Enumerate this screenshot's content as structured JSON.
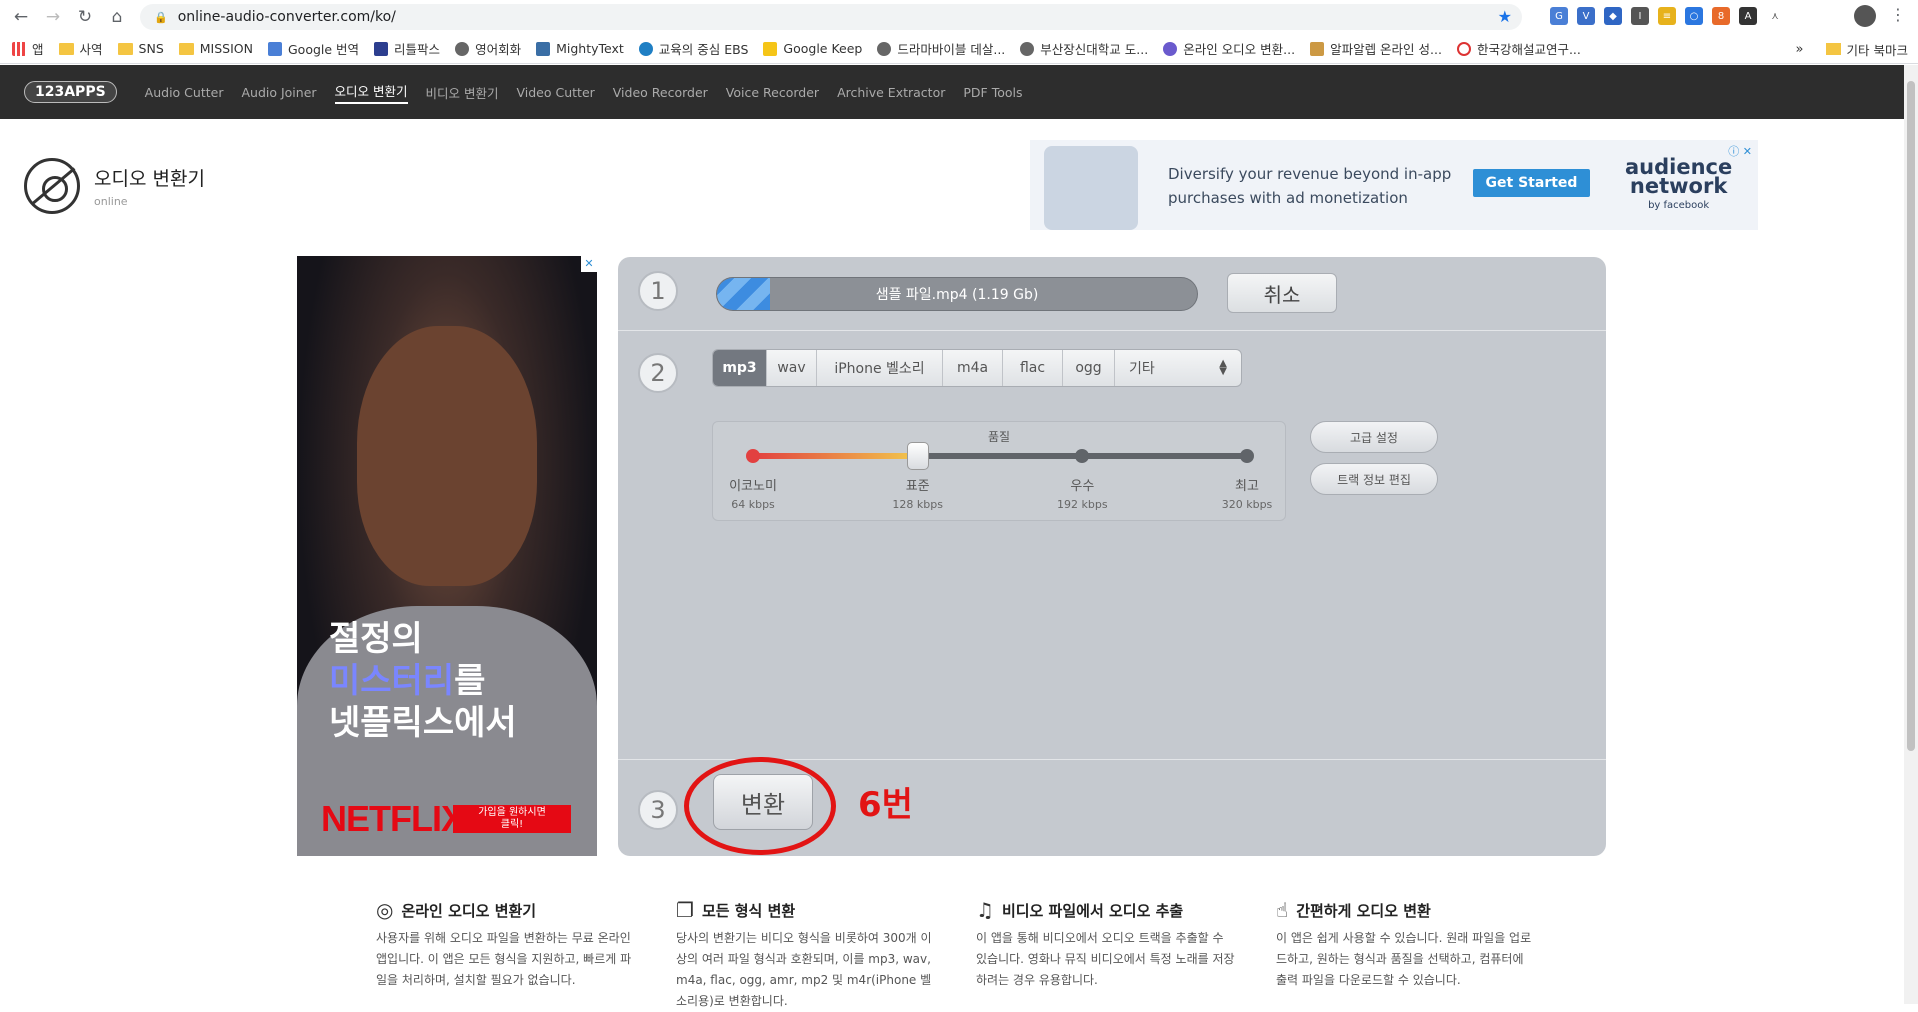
{
  "browser": {
    "url": "online-audio-converter.com/ko/",
    "bookmarks": [
      "앱",
      "사역",
      "SNS",
      "MISSION",
      "Google 번역",
      "리틀팍스",
      "영어회화",
      "MightyText",
      "교육의 중심 EBS",
      "Google Keep",
      "드라마바이블 데살...",
      "부산장신대학교 도...",
      "온라인 오디오 변환...",
      "알파알렙 온라인 성...",
      "한국강해설교연구..."
    ],
    "bookmarks_overflow": "»",
    "other_bookmarks": "기타 북마크"
  },
  "site_nav": {
    "logo": "123APPS",
    "links": [
      "Audio Cutter",
      "Audio Joiner",
      "오디오 변환기",
      "비디오 변환기",
      "Video Cutter",
      "Video Recorder",
      "Voice Recorder",
      "Archive Extractor",
      "PDF Tools"
    ],
    "active_index": 2
  },
  "app": {
    "name": "오디오 변환기",
    "sub": "online"
  },
  "top_ad": {
    "copy_line1": "Diversify your revenue beyond in-app",
    "copy_line2": "purchases with ad monetization",
    "cta": "Get Started",
    "brand_line1": "audience",
    "brand_line2": "network",
    "brand_line3": "by facebook"
  },
  "side_ad": {
    "line1": "절정의",
    "line2_highlight": "미스터리",
    "line2_rest": "를",
    "line3": "넷플릭스에서",
    "brand": "NETFLIX",
    "cta_line1": "가입을 원하시면",
    "cta_line2": "클릭!"
  },
  "converter": {
    "step1": {
      "num": "1",
      "file_label": "샘플 파일.mp4 (1.19 Gb)",
      "progress": 0.11,
      "cancel": "취소"
    },
    "step2": {
      "num": "2",
      "formats": [
        "mp3",
        "wav",
        "iPhone 벨소리",
        "m4a",
        "flac",
        "ogg",
        "기타"
      ],
      "active_format": "mp3",
      "quality_title": "품질",
      "quality_levels": [
        {
          "name": "이코노미",
          "kbps": "64 kbps"
        },
        {
          "name": "표준",
          "kbps": "128 kbps"
        },
        {
          "name": "우수",
          "kbps": "192 kbps"
        },
        {
          "name": "최고",
          "kbps": "320 kbps"
        }
      ],
      "quality_selected_index": 1,
      "advanced": "고급 설정",
      "edit_tags": "트랙 정보 편집"
    },
    "step3": {
      "num": "3",
      "convert": "변환"
    }
  },
  "annotation": {
    "label": "6번",
    "color": "#e21414"
  },
  "features": [
    {
      "icon": "◎",
      "title": "온라인 오디오 변환기",
      "desc": "사용자를 위해 오디오 파일을 변환하는 무료 온라인 앱입니다. 이 앱은 모든 형식을 지원하고, 빠르게 파일을 처리하며, 설치할 필요가 없습니다."
    },
    {
      "icon": "❐",
      "title": "모든 형식 변환",
      "desc": "당사의 변환기는 비디오 형식을 비롯하여 300개 이상의 여러 파일 형식과 호환되며, 이를 mp3, wav, m4a, flac, ogg, amr, mp2 및 m4r(iPhone 벨소리용)로 변환합니다."
    },
    {
      "icon": "♫",
      "title": "비디오 파일에서 오디오 추출",
      "desc": "이 앱을 통해 비디오에서 오디오 트랙을 추출할 수 있습니다. 영화나 뮤직 비디오에서 특정 노래를 저장하려는 경우 유용합니다."
    },
    {
      "icon": "☝",
      "title": "간편하게 오디오 변환",
      "desc": "이 앱은 쉽게 사용할 수 있습니다. 원래 파일을 업로드하고, 원하는 형식과 품질을 선택하고, 컴퓨터에 출력 파일을 다운로드할 수 있습니다."
    }
  ]
}
